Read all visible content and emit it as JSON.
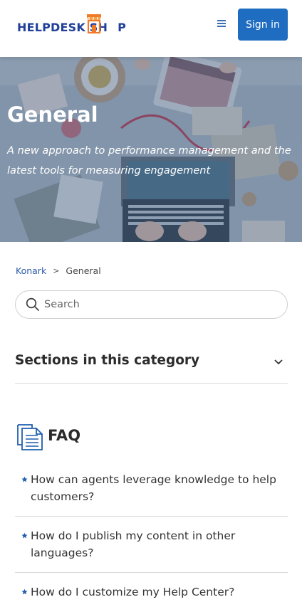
{
  "header": {
    "logo_text": "HELPDESK SH",
    "logo_tail": "P",
    "signin_label": "Sign in"
  },
  "hero": {
    "title": "General",
    "subtitle": "A new approach to performance management and the latest tools for measuring engagement"
  },
  "breadcrumb": {
    "home": "Konark",
    "separator": ">",
    "current": "General"
  },
  "search": {
    "placeholder": "Search"
  },
  "sections": {
    "title": "Sections in this category"
  },
  "faq": {
    "title": "FAQ",
    "articles": [
      {
        "title": "How can agents leverage knowledge to help customers?"
      },
      {
        "title": "How do I publish my content in other languages?"
      },
      {
        "title": "How do I customize my Help Center?"
      }
    ]
  },
  "colors": {
    "brand": "#22409a",
    "accent_orange": "#f07a28",
    "button": "#1f6dc1",
    "star": "#1f5fae"
  },
  "icons": [
    "menu-icon",
    "search-icon",
    "chevron-down-icon",
    "document-icon",
    "star-icon",
    "shop-icon"
  ]
}
